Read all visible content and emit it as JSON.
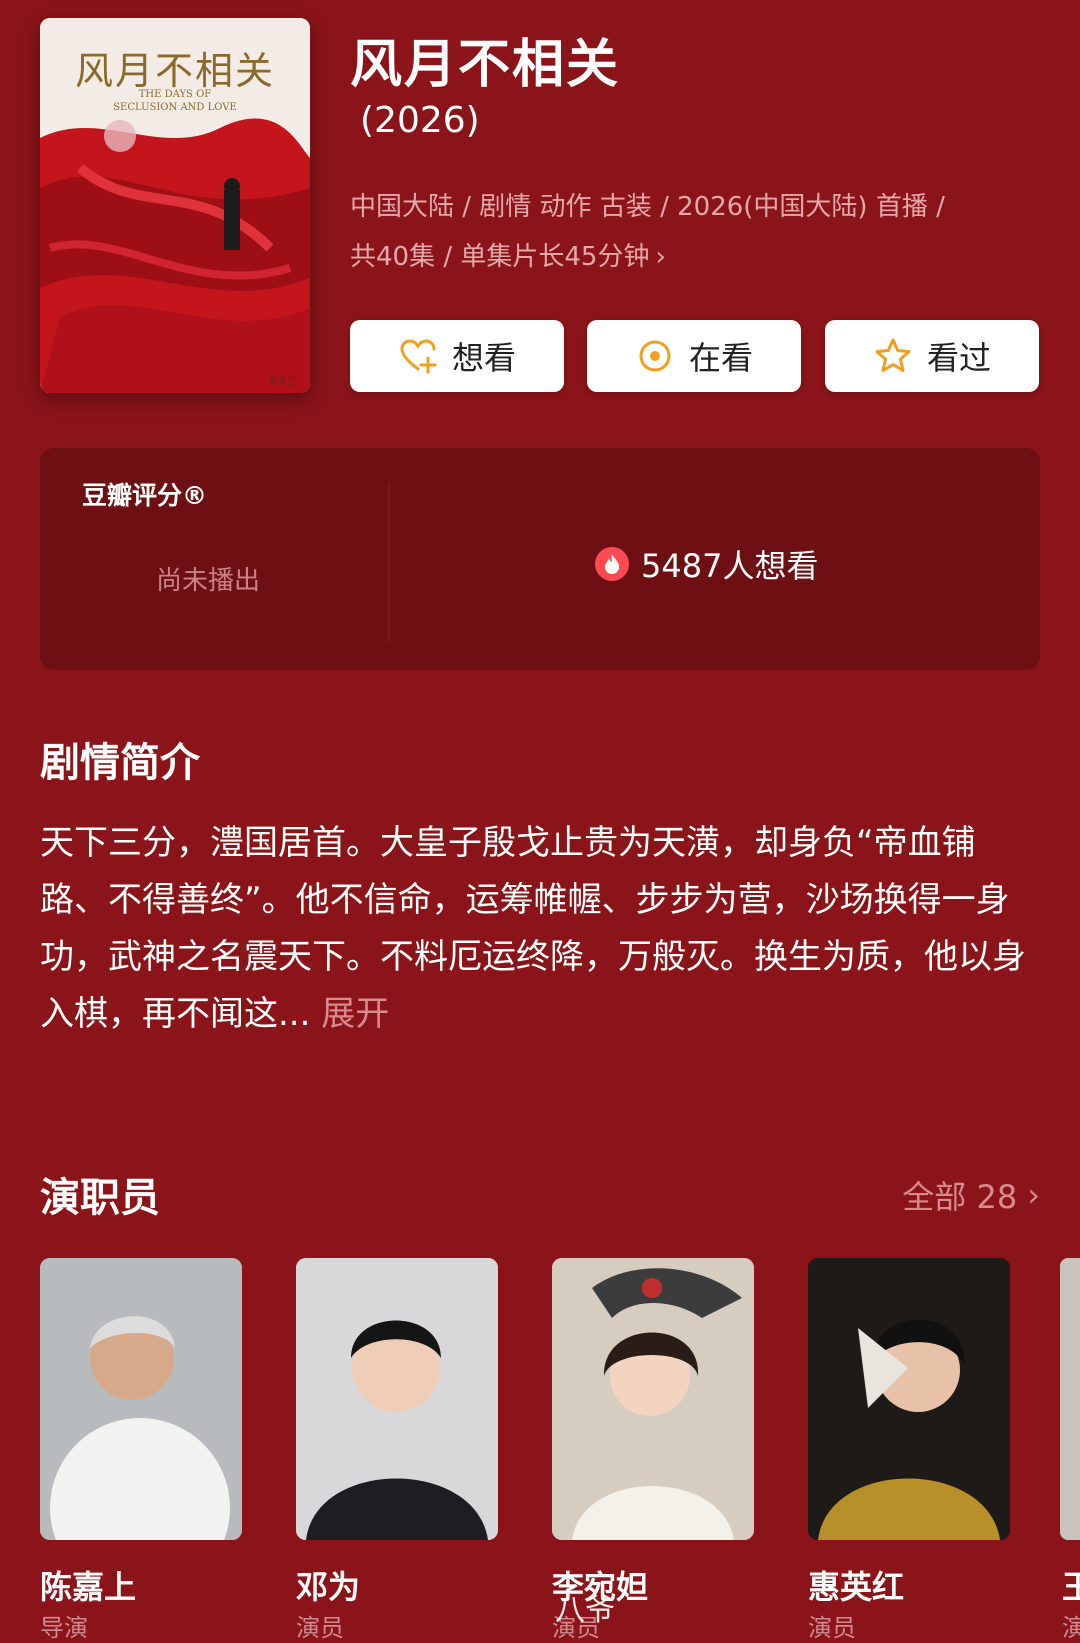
{
  "poster": {
    "title_cn": "风月不相关",
    "title_en_line1": "THE DAYS OF",
    "title_en_line2": "SECLUSION AND LOVE",
    "logo": "爱奇艺"
  },
  "show": {
    "title": "风月不相关",
    "year": "(2026)",
    "meta_line1": "中国大陆 / 剧情 动作 古装 / 2026(中国大陆) 首播 /",
    "meta_line2": "共40集 / 单集片长45分钟"
  },
  "actions": {
    "want": "想看",
    "watching": "在看",
    "watched": "看过"
  },
  "rating": {
    "label": "豆瓣评分®",
    "status": "尚未播出",
    "wish_count": "5487人想看"
  },
  "synopsis": {
    "heading": "剧情简介",
    "text": "天下三分，澧国居首。大皇子殷戈止贵为天潢，却身负“帝血铺路、不得善终”。他不信命，运筹帷幄、步步为营，沙场换得一身功，武神之名震天下。不料厄运终降，万般灭。换生为质，他以身入棋，再不闻这...",
    "expand": "展开"
  },
  "cast": {
    "heading": "演职员",
    "all_label": "全部 28",
    "members": [
      {
        "name": "陈嘉上",
        "role": "导演"
      },
      {
        "name": "邓为",
        "role": "演员"
      },
      {
        "name": "李宛妲",
        "role": "演员"
      },
      {
        "name": "惠英红",
        "role": "演员"
      },
      {
        "name": "王",
        "role": "演"
      }
    ]
  },
  "watermark": "八爷",
  "colors": {
    "background": "#8a1419",
    "card": "#6e0f13",
    "accent_gold": "#f0a020",
    "muted_text": "#e5a8aa"
  }
}
